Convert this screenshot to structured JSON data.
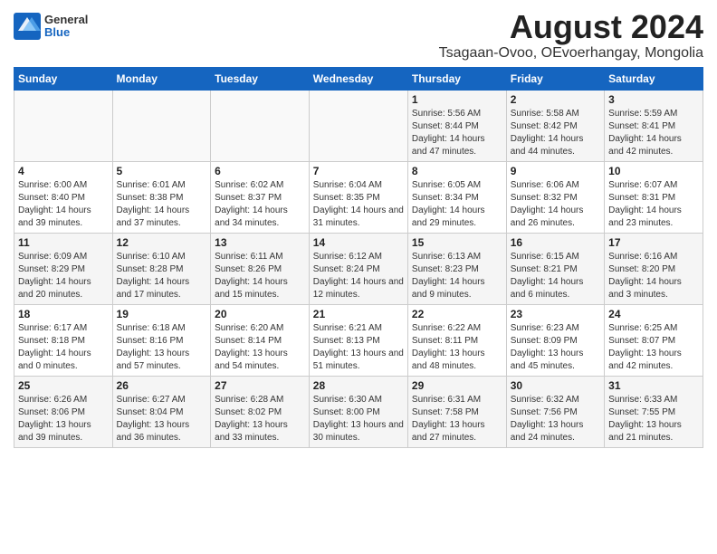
{
  "header": {
    "logo_general": "General",
    "logo_blue": "Blue",
    "title": "August 2024",
    "subtitle": "Tsagaan-Ovoo, OEvoerhangay, Mongolia"
  },
  "days_of_week": [
    "Sunday",
    "Monday",
    "Tuesday",
    "Wednesday",
    "Thursday",
    "Friday",
    "Saturday"
  ],
  "weeks": [
    [
      {
        "day": "",
        "detail": ""
      },
      {
        "day": "",
        "detail": ""
      },
      {
        "day": "",
        "detail": ""
      },
      {
        "day": "",
        "detail": ""
      },
      {
        "day": "1",
        "detail": "Sunrise: 5:56 AM\nSunset: 8:44 PM\nDaylight: 14 hours\nand 47 minutes."
      },
      {
        "day": "2",
        "detail": "Sunrise: 5:58 AM\nSunset: 8:42 PM\nDaylight: 14 hours\nand 44 minutes."
      },
      {
        "day": "3",
        "detail": "Sunrise: 5:59 AM\nSunset: 8:41 PM\nDaylight: 14 hours\nand 42 minutes."
      }
    ],
    [
      {
        "day": "4",
        "detail": "Sunrise: 6:00 AM\nSunset: 8:40 PM\nDaylight: 14 hours\nand 39 minutes."
      },
      {
        "day": "5",
        "detail": "Sunrise: 6:01 AM\nSunset: 8:38 PM\nDaylight: 14 hours\nand 37 minutes."
      },
      {
        "day": "6",
        "detail": "Sunrise: 6:02 AM\nSunset: 8:37 PM\nDaylight: 14 hours\nand 34 minutes."
      },
      {
        "day": "7",
        "detail": "Sunrise: 6:04 AM\nSunset: 8:35 PM\nDaylight: 14 hours\nand 31 minutes."
      },
      {
        "day": "8",
        "detail": "Sunrise: 6:05 AM\nSunset: 8:34 PM\nDaylight: 14 hours\nand 29 minutes."
      },
      {
        "day": "9",
        "detail": "Sunrise: 6:06 AM\nSunset: 8:32 PM\nDaylight: 14 hours\nand 26 minutes."
      },
      {
        "day": "10",
        "detail": "Sunrise: 6:07 AM\nSunset: 8:31 PM\nDaylight: 14 hours\nand 23 minutes."
      }
    ],
    [
      {
        "day": "11",
        "detail": "Sunrise: 6:09 AM\nSunset: 8:29 PM\nDaylight: 14 hours\nand 20 minutes."
      },
      {
        "day": "12",
        "detail": "Sunrise: 6:10 AM\nSunset: 8:28 PM\nDaylight: 14 hours\nand 17 minutes."
      },
      {
        "day": "13",
        "detail": "Sunrise: 6:11 AM\nSunset: 8:26 PM\nDaylight: 14 hours\nand 15 minutes."
      },
      {
        "day": "14",
        "detail": "Sunrise: 6:12 AM\nSunset: 8:24 PM\nDaylight: 14 hours\nand 12 minutes."
      },
      {
        "day": "15",
        "detail": "Sunrise: 6:13 AM\nSunset: 8:23 PM\nDaylight: 14 hours\nand 9 minutes."
      },
      {
        "day": "16",
        "detail": "Sunrise: 6:15 AM\nSunset: 8:21 PM\nDaylight: 14 hours\nand 6 minutes."
      },
      {
        "day": "17",
        "detail": "Sunrise: 6:16 AM\nSunset: 8:20 PM\nDaylight: 14 hours\nand 3 minutes."
      }
    ],
    [
      {
        "day": "18",
        "detail": "Sunrise: 6:17 AM\nSunset: 8:18 PM\nDaylight: 14 hours\nand 0 minutes."
      },
      {
        "day": "19",
        "detail": "Sunrise: 6:18 AM\nSunset: 8:16 PM\nDaylight: 13 hours\nand 57 minutes."
      },
      {
        "day": "20",
        "detail": "Sunrise: 6:20 AM\nSunset: 8:14 PM\nDaylight: 13 hours\nand 54 minutes."
      },
      {
        "day": "21",
        "detail": "Sunrise: 6:21 AM\nSunset: 8:13 PM\nDaylight: 13 hours\nand 51 minutes."
      },
      {
        "day": "22",
        "detail": "Sunrise: 6:22 AM\nSunset: 8:11 PM\nDaylight: 13 hours\nand 48 minutes."
      },
      {
        "day": "23",
        "detail": "Sunrise: 6:23 AM\nSunset: 8:09 PM\nDaylight: 13 hours\nand 45 minutes."
      },
      {
        "day": "24",
        "detail": "Sunrise: 6:25 AM\nSunset: 8:07 PM\nDaylight: 13 hours\nand 42 minutes."
      }
    ],
    [
      {
        "day": "25",
        "detail": "Sunrise: 6:26 AM\nSunset: 8:06 PM\nDaylight: 13 hours\nand 39 minutes."
      },
      {
        "day": "26",
        "detail": "Sunrise: 6:27 AM\nSunset: 8:04 PM\nDaylight: 13 hours\nand 36 minutes."
      },
      {
        "day": "27",
        "detail": "Sunrise: 6:28 AM\nSunset: 8:02 PM\nDaylight: 13 hours\nand 33 minutes."
      },
      {
        "day": "28",
        "detail": "Sunrise: 6:30 AM\nSunset: 8:00 PM\nDaylight: 13 hours\nand 30 minutes."
      },
      {
        "day": "29",
        "detail": "Sunrise: 6:31 AM\nSunset: 7:58 PM\nDaylight: 13 hours\nand 27 minutes."
      },
      {
        "day": "30",
        "detail": "Sunrise: 6:32 AM\nSunset: 7:56 PM\nDaylight: 13 hours\nand 24 minutes."
      },
      {
        "day": "31",
        "detail": "Sunrise: 6:33 AM\nSunset: 7:55 PM\nDaylight: 13 hours\nand 21 minutes."
      }
    ]
  ]
}
